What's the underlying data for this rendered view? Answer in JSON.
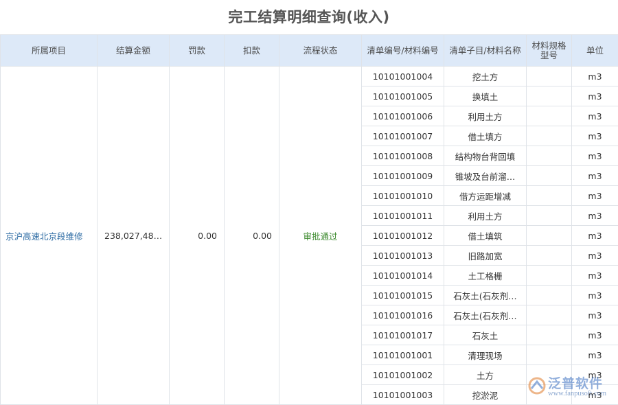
{
  "page": {
    "title": "完工结算明细查询(收入)"
  },
  "table": {
    "columns": {
      "project": "所属项目",
      "amount": "结算金额",
      "penalty": "罚款",
      "deduction": "扣款",
      "status": "流程状态",
      "code": "清单编号/材料编号",
      "name": "清单子目/材料名称",
      "spec": "材料规格型号",
      "unit": "单位"
    },
    "summary": {
      "project": "京沪高速北京段维修",
      "amount": "238,027,48…",
      "penalty": "0.00",
      "deduction": "0.00",
      "status": "审批通过"
    },
    "rows": [
      {
        "code": "10101001004",
        "name": "挖土方",
        "spec": "",
        "unit": "m3"
      },
      {
        "code": "10101001005",
        "name": "换填土",
        "spec": "",
        "unit": "m3"
      },
      {
        "code": "10101001006",
        "name": "利用土方",
        "spec": "",
        "unit": "m3"
      },
      {
        "code": "10101001007",
        "name": "借土填方",
        "spec": "",
        "unit": "m3"
      },
      {
        "code": "10101001008",
        "name": "结构物台背回填",
        "spec": "",
        "unit": "m3"
      },
      {
        "code": "10101001009",
        "name": "锥坡及台前溜…",
        "spec": "",
        "unit": "m3"
      },
      {
        "code": "10101001010",
        "name": "借方运距增减",
        "spec": "",
        "unit": "m3"
      },
      {
        "code": "10101001011",
        "name": "利用土方",
        "spec": "",
        "unit": "m3"
      },
      {
        "code": "10101001012",
        "name": "借土填筑",
        "spec": "",
        "unit": "m3"
      },
      {
        "code": "10101001013",
        "name": "旧路加宽",
        "spec": "",
        "unit": "m3"
      },
      {
        "code": "10101001014",
        "name": "土工格栅",
        "spec": "",
        "unit": "m3"
      },
      {
        "code": "10101001015",
        "name": "石灰土(石灰剂…",
        "spec": "",
        "unit": "m3"
      },
      {
        "code": "10101001016",
        "name": "石灰土(石灰剂…",
        "spec": "",
        "unit": "m3"
      },
      {
        "code": "10101001017",
        "name": "石灰土",
        "spec": "",
        "unit": "m3"
      },
      {
        "code": "10101001001",
        "name": "清理现场",
        "spec": "",
        "unit": "m3"
      },
      {
        "code": "10101001002",
        "name": "土方",
        "spec": "",
        "unit": "m3"
      },
      {
        "code": "10101001003",
        "name": "挖淤泥",
        "spec": "",
        "unit": "m3"
      }
    ]
  },
  "watermark": {
    "brand": "泛普软件",
    "url": "www.fanpusoft.com"
  },
  "colors": {
    "header_bg": "#dde9f8",
    "project_link": "#2e6ca4",
    "status_ok": "#3c8a2e",
    "border": "#dfe3e8"
  }
}
